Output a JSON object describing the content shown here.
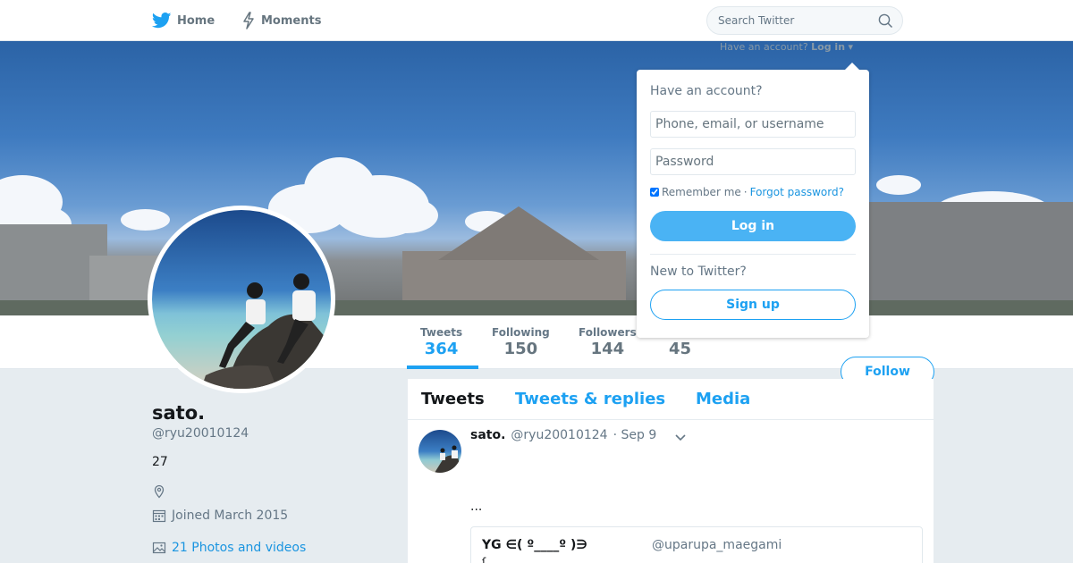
{
  "topbar": {
    "home_label": "Home",
    "moments_label": "Moments",
    "search_placeholder": "Search Twitter",
    "have_account_text": "Have an account?",
    "login_link": "Log in"
  },
  "colors": {
    "accent": "#1da1f2",
    "link": "#1b95e0",
    "login_button": "#4ab3f4"
  },
  "icons": {
    "home": "bird-icon",
    "moments": "lightning-icon",
    "search": "search-icon",
    "location": "location-pin-icon",
    "calendar": "calendar-icon",
    "photos": "image-icon",
    "caret": "chevron-down-icon"
  },
  "stats": [
    {
      "label": "Tweets",
      "value": "364"
    },
    {
      "label": "Following",
      "value": "150"
    },
    {
      "label": "Followers",
      "value": "144"
    },
    {
      "label": "",
      "value": "45"
    }
  ],
  "follow_label": "Follow",
  "profile": {
    "name": "sato.",
    "handle": "@ryu20010124",
    "bio": "27",
    "joined": "Joined March 2015",
    "photos_link": "21 Photos and videos"
  },
  "tabs": [
    "Tweets",
    "Tweets & replies",
    "Media"
  ],
  "tweet": {
    "name": "sato.",
    "handle": "@ryu20010124",
    "date": "· Sep 9",
    "text": "...",
    "quote": {
      "name": "YG ∈( º____º )∋",
      "handle": "@uparupa_maegami",
      "extra": "ſ"
    }
  },
  "login_dropdown": {
    "title": "Have an account?",
    "username_placeholder": "Phone, email, or username",
    "password_placeholder": "Password",
    "remember_label": "Remember me",
    "separator": "·",
    "forgot_label": "Forgot password?",
    "login_button": "Log in",
    "new_label": "New to Twitter?",
    "signup_button": "Sign up"
  }
}
